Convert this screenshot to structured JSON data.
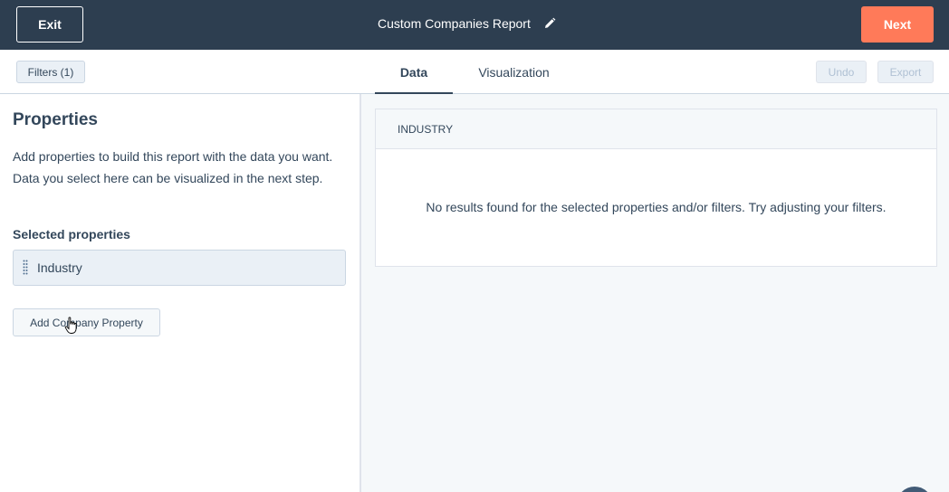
{
  "topbar": {
    "exit_label": "Exit",
    "report_title": "Custom Companies Report",
    "edit_icon": "pencil-icon",
    "next_label": "Next"
  },
  "subbar": {
    "filters_label": "Filters (1)",
    "tabs": [
      {
        "label": "Data",
        "active": true
      },
      {
        "label": "Visualization",
        "active": false
      }
    ],
    "undo_label": "Undo",
    "export_label": "Export"
  },
  "properties": {
    "title": "Properties",
    "description": "Add properties to build this report with the data you want. Data you select here can be visualized in the next step.",
    "selected_label": "Selected properties",
    "selected": [
      {
        "label": "Industry"
      }
    ],
    "add_button_label": "Add Company Property"
  },
  "results": {
    "columns": [
      "INDUSTRY"
    ],
    "empty_message": "No results found for the selected properties and/or filters. Try adjusting your filters."
  },
  "colors": {
    "topbar_bg": "#2d3e50",
    "accent": "#ff7a59",
    "text": "#33475b"
  }
}
